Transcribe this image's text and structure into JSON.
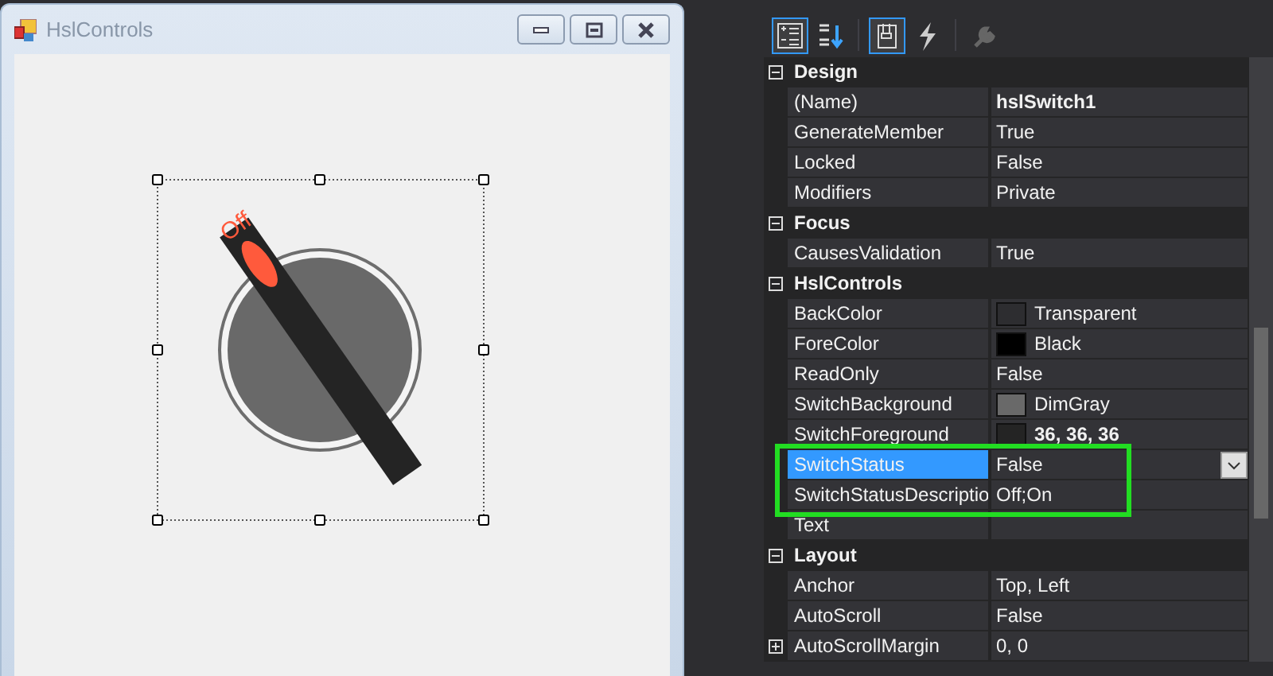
{
  "form_window": {
    "title": "HslControls",
    "switch": {
      "label": "Off",
      "on": false
    }
  },
  "properties_toolbar": [
    {
      "kind": "categorized",
      "selected": true
    },
    {
      "kind": "alphabetical",
      "selected": false
    },
    {
      "kind": "properties",
      "selected": true
    },
    {
      "kind": "events",
      "selected": false
    },
    {
      "kind": "pages",
      "selected": false
    }
  ],
  "property_grid": [
    {
      "kind": "category",
      "label": "Design",
      "expanded": true
    },
    {
      "kind": "property",
      "name": "(Name)",
      "value": "hslSwitch1",
      "bold": true
    },
    {
      "kind": "property",
      "name": "GenerateMember",
      "value": "True"
    },
    {
      "kind": "property",
      "name": "Locked",
      "value": "False"
    },
    {
      "kind": "property",
      "name": "Modifiers",
      "value": "Private"
    },
    {
      "kind": "category",
      "label": "Focus",
      "expanded": true
    },
    {
      "kind": "property",
      "name": "CausesValidation",
      "value": "True"
    },
    {
      "kind": "category",
      "label": "HslControls",
      "expanded": true
    },
    {
      "kind": "property",
      "name": "BackColor",
      "value": "Transparent",
      "color": "#2d2d30"
    },
    {
      "kind": "property",
      "name": "ForeColor",
      "value": "Black",
      "color": "#000000"
    },
    {
      "kind": "property",
      "name": "ReadOnly",
      "value": "False"
    },
    {
      "kind": "property",
      "name": "SwitchBackground",
      "value": "DimGray",
      "color": "#696969"
    },
    {
      "kind": "property",
      "name": "SwitchForeground",
      "value": "36, 36, 36",
      "bold": true,
      "color": "#242424"
    },
    {
      "kind": "property",
      "name": "SwitchStatus",
      "value": "False",
      "selected": true,
      "highlighted": true
    },
    {
      "kind": "property",
      "name": "SwitchStatusDescriptio",
      "value": "Off;On",
      "highlighted": true
    },
    {
      "kind": "property",
      "name": "Text"
    },
    {
      "kind": "category",
      "label": "Layout",
      "expanded": true
    },
    {
      "kind": "property",
      "name": "Anchor",
      "value": "Top, Left"
    },
    {
      "kind": "property",
      "name": "AutoScroll",
      "value": "False"
    },
    {
      "kind": "property",
      "name": "AutoScrollMargin",
      "value": "0, 0",
      "expanded": false
    }
  ]
}
